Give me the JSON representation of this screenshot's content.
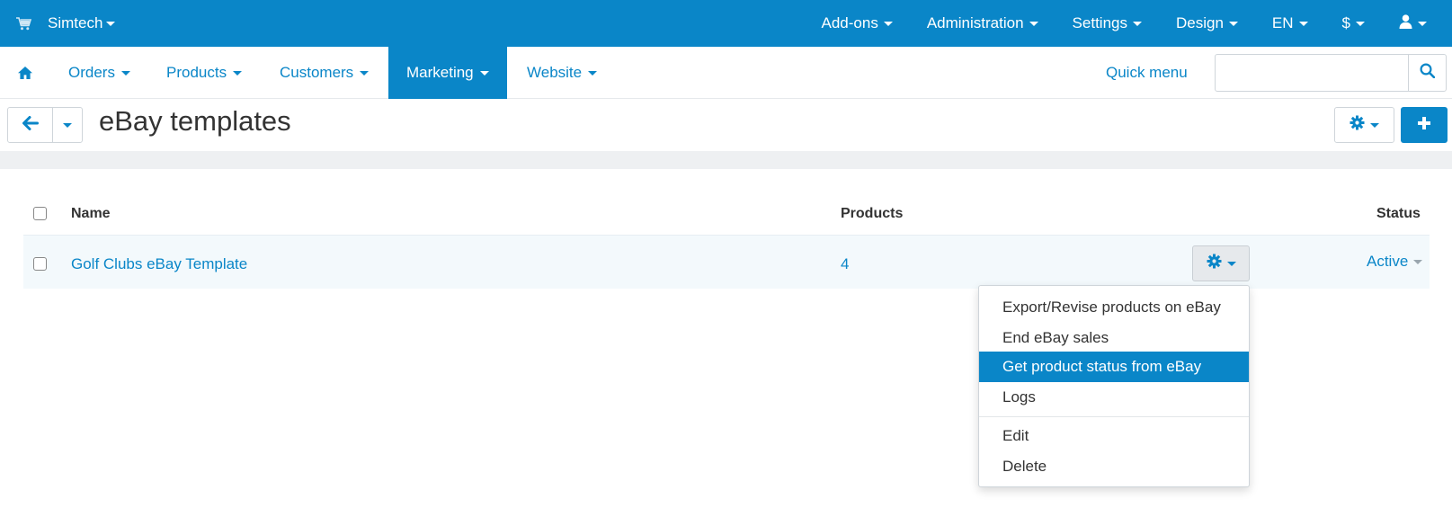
{
  "topbar": {
    "store_name": "Simtech",
    "menu": [
      {
        "label": "Add-ons"
      },
      {
        "label": "Administration"
      },
      {
        "label": "Settings"
      },
      {
        "label": "Design"
      },
      {
        "label": "EN"
      },
      {
        "label": "$"
      }
    ]
  },
  "mainnav": {
    "items": [
      {
        "label": "Orders"
      },
      {
        "label": "Products"
      },
      {
        "label": "Customers"
      },
      {
        "label": "Marketing"
      },
      {
        "label": "Website"
      }
    ],
    "active": "Marketing",
    "quick_menu": "Quick menu",
    "search_value": ""
  },
  "page": {
    "title": "eBay templates"
  },
  "table": {
    "columns": [
      "Name",
      "Products",
      "Status"
    ],
    "rows": [
      {
        "name": "Golf Clubs eBay Template",
        "products": "4",
        "status": "Active"
      }
    ]
  },
  "dropdown": {
    "items": [
      {
        "label": "Export/Revise products on eBay"
      },
      {
        "label": "End eBay sales"
      },
      {
        "label": "Get product status from eBay"
      },
      {
        "label": "Logs"
      },
      {
        "label": "Edit"
      },
      {
        "label": "Delete"
      }
    ],
    "highlighted": "Get product status from eBay"
  },
  "colors": {
    "accent": "#0a86c8",
    "band": "#eef0f2",
    "row_bg": "#f3f9fc"
  },
  "icons": [
    "cart-icon",
    "home-icon",
    "user-icon",
    "search-icon",
    "back-arrow-icon",
    "gear-icon",
    "plus-icon",
    "chevron-down-icon"
  ]
}
